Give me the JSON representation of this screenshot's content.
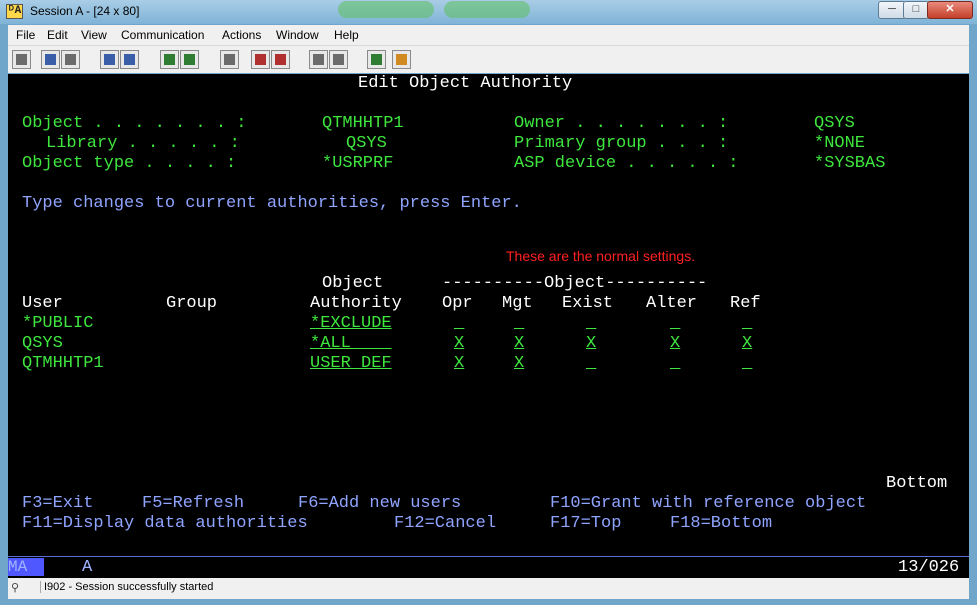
{
  "window": {
    "title": "Session A - [24 x 80]",
    "app_icon_text": "ᴰA",
    "controls": {
      "minimize": "─",
      "maximize": "□",
      "close": "✕"
    }
  },
  "menu": [
    "File",
    "Edit",
    "View",
    "Communication",
    "Actions",
    "Window",
    "Help"
  ],
  "screen": {
    "title": "Edit Object Authority",
    "fields": {
      "object_label": "Object . . . . . . . :",
      "object_value": "QTMHHTP1",
      "library_label": "Library . . . . . :",
      "library_value": "QSYS",
      "object_type_label": "Object type . . . . :",
      "object_type_value": "*USRPRF",
      "owner_label": "Owner . . . . . . . :",
      "owner_value": "QSYS",
      "primary_group_label": "Primary group . . . :",
      "primary_group_value": "*NONE",
      "asp_device_label": "ASP device . . . . . :",
      "asp_device_value": "*SYSBAS"
    },
    "instruction": "Type changes to current authorities, press Enter.",
    "annotation": "These are the normal settings.",
    "headers": {
      "object_top": "Object",
      "object_group": "----------Object----------",
      "user": "User",
      "group": "Group",
      "authority": "Authority",
      "opr": "Opr",
      "mgt": "Mgt",
      "exist": "Exist",
      "alter": "Alter",
      "ref": "Ref"
    },
    "rows": [
      {
        "user": "*PUBLIC",
        "authority": "*EXCLUDE",
        "opr": "_",
        "mgt": "_",
        "exist": "_",
        "alter": "_",
        "ref": "_"
      },
      {
        "user": "QSYS",
        "authority": "*ALL    ",
        "opr": "X",
        "mgt": "X",
        "exist": "X",
        "alter": "X",
        "ref": "X"
      },
      {
        "user": "QTMHHTP1",
        "authority": "USER DEF",
        "opr": "X",
        "mgt": "X",
        "exist": "_",
        "alter": "_",
        "ref": "_"
      }
    ],
    "bottom_indicator": "Bottom",
    "fkeys_line1": {
      "f3": "F3=Exit",
      "f5": "F5=Refresh",
      "f6": "F6=Add new users",
      "f10": "F10=Grant with reference object"
    },
    "fkeys_line2": {
      "f11": "F11=Display data authorities",
      "f12": "F12=Cancel",
      "f17": "F17=Top",
      "f18": "F18=Bottom"
    }
  },
  "oia": {
    "indicator": "MA",
    "mode": "A",
    "cursor_position": "13/026"
  },
  "status_bar": {
    "message": "I902 - Session successfully started"
  }
}
